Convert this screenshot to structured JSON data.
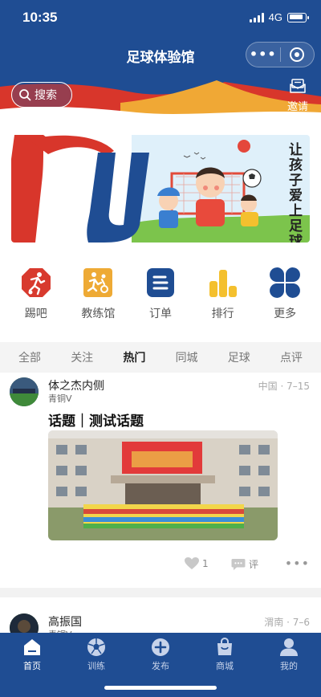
{
  "status_bar": {
    "time": "10:35",
    "network": "4G"
  },
  "header": {
    "title": "足球体验馆"
  },
  "search": {
    "label": "搜索"
  },
  "invite": {
    "label": "邀请"
  },
  "banner": {
    "slogan": "让孩子爱上足球"
  },
  "grid": [
    {
      "label": "踢吧",
      "icon": "running-player-icon",
      "color": "#d83a2e"
    },
    {
      "label": "教练馆",
      "icon": "coach-icon",
      "color": "#eeaa35"
    },
    {
      "label": "订单",
      "icon": "document-icon",
      "color": "#1f4d93"
    },
    {
      "label": "排行",
      "icon": "bar-chart-icon",
      "color": "#f4c02e"
    },
    {
      "label": "更多",
      "icon": "four-leaf-icon",
      "color": "#1f4d93"
    }
  ],
  "tabs": [
    {
      "label": "全部",
      "active": false
    },
    {
      "label": "关注",
      "active": false
    },
    {
      "label": "热门",
      "active": true
    },
    {
      "label": "同城",
      "active": false
    },
    {
      "label": "足球",
      "active": false
    },
    {
      "label": "点评",
      "active": false
    }
  ],
  "posts": [
    {
      "author": "体之杰内侧",
      "sub": "青铜V",
      "meta": "中国 · 7–15",
      "title": "话题｜测试话题",
      "likes": "1",
      "comment_label": "评"
    },
    {
      "author": "高振国",
      "sub": "青铜V",
      "meta": "渭南 · 7–6"
    }
  ],
  "bottom_nav": [
    {
      "label": "首页",
      "icon": "home-icon",
      "active": true
    },
    {
      "label": "训练",
      "icon": "soccer-ball-icon",
      "active": false
    },
    {
      "label": "发布",
      "icon": "plus-icon",
      "active": false
    },
    {
      "label": "商城",
      "icon": "shopping-bag-icon",
      "active": false
    },
    {
      "label": "我的",
      "icon": "user-icon",
      "active": false
    }
  ],
  "colors": {
    "primary": "#1f4d93",
    "accent_red": "#d83a2e",
    "accent_yellow": "#f4c02e"
  }
}
